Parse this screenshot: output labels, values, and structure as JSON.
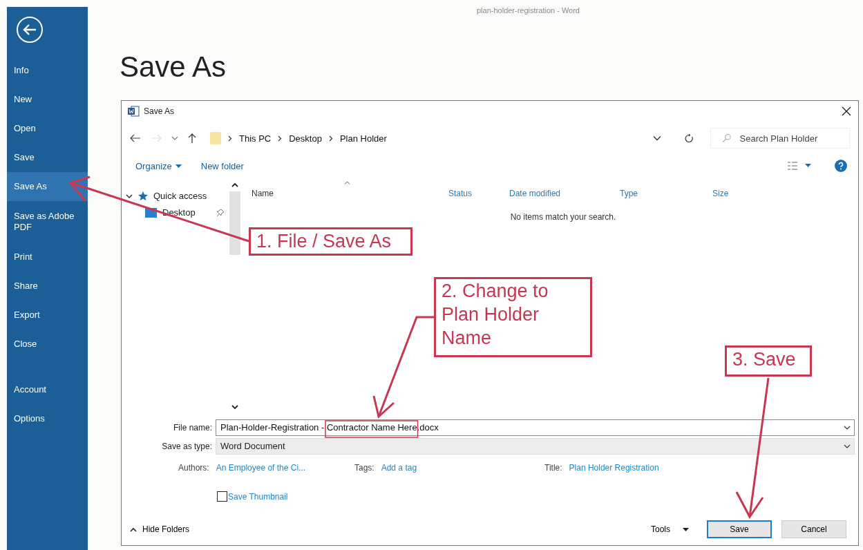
{
  "window": {
    "title": "plan-holder-registration - Word"
  },
  "backstage": {
    "nav": [
      {
        "label": "Info",
        "selected": false
      },
      {
        "label": "New",
        "selected": false
      },
      {
        "label": "Open",
        "selected": false
      },
      {
        "label": "Save",
        "selected": false
      },
      {
        "label": "Save As",
        "selected": true
      },
      {
        "label": "Save as Adobe PDF",
        "selected": false
      },
      {
        "label": "Print",
        "selected": false
      },
      {
        "label": "Share",
        "selected": false
      },
      {
        "label": "Export",
        "selected": false
      },
      {
        "label": "Close",
        "selected": false
      }
    ],
    "footer": [
      {
        "label": "Account",
        "selected": false
      },
      {
        "label": "Options",
        "selected": false
      }
    ]
  },
  "heading": "Save As",
  "dialog": {
    "title": "Save As",
    "breadcrumb": [
      "This PC",
      "Desktop",
      "Plan Holder"
    ],
    "search": {
      "placeholder": "Search Plan Holder"
    },
    "toolbar": [
      "Organize",
      "New folder"
    ],
    "nav_tree": [
      {
        "label": "Quick access",
        "expanded": true,
        "children": [
          {
            "label": "Desktop",
            "pinned": true
          }
        ]
      }
    ],
    "columns": [
      "Name",
      "Status",
      "Date modified",
      "Type",
      "Size"
    ],
    "empty_message": "No items match your search.",
    "file_name": {
      "label": "File name:",
      "value": "Plan-Holder-Registration - Contractor Name Here.docx"
    },
    "save_as_type": {
      "label": "Save as type:",
      "value": "Word Document"
    },
    "properties": [
      {
        "label": "Authors:",
        "value": "An Employee of the Ci..."
      },
      {
        "label": "Tags:",
        "value": "Add a tag"
      },
      {
        "label": "Title:",
        "value": "Plan Holder Registration"
      }
    ],
    "save_thumbnail": {
      "label": "Save Thumbnail",
      "checked": false
    },
    "hide_folders": "Hide Folders",
    "tools": "Tools",
    "buttons": [
      {
        "label": "Save",
        "default": true
      },
      {
        "label": "Cancel",
        "default": false
      }
    ]
  },
  "annotations": [
    {
      "text": "1. File / Save As"
    },
    {
      "text": "2. Change to Plan Holder Name"
    },
    {
      "text": "3. Save"
    }
  ]
}
